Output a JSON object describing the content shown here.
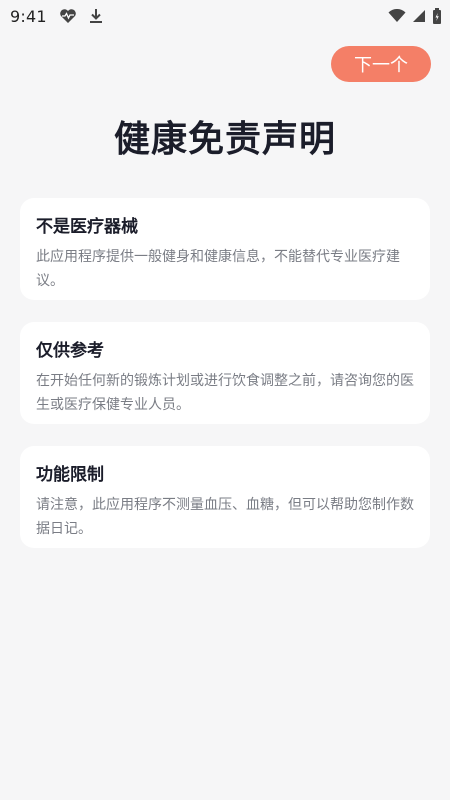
{
  "status_bar": {
    "time": "9:41",
    "icons_left": [
      "heart-rate-icon",
      "download-icon"
    ],
    "icons_right": [
      "wifi-icon",
      "signal-icon",
      "battery-icon"
    ]
  },
  "header": {
    "next_label": "下一个",
    "accent_color": "#f47f67"
  },
  "title": "健康免责声明",
  "cards": [
    {
      "title": "不是医疗器械",
      "body": "此应用程序提供一般健身和健康信息，不能替代专业医疗建议。"
    },
    {
      "title": "仅供参考",
      "body": "在开始任何新的锻炼计划或进行饮食调整之前，请咨询您的医生或医疗保健专业人员。"
    },
    {
      "title": "功能限制",
      "body": "请注意，此应用程序不测量血压、血糖，但可以帮助您制作数据日记。"
    }
  ]
}
